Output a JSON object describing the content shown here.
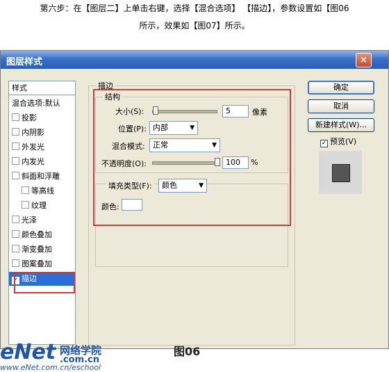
{
  "instruction": {
    "line1": "第六步：在【图层二】上单击右键，选择【混合选项】  【描边】，参数设置如【图06",
    "line2": "所示，效果如【图07】所示。"
  },
  "dialog": {
    "title": "图层样式",
    "close_glyph": "×",
    "left_panel": {
      "header": "样式",
      "items": [
        {
          "label": "混合选项:默认",
          "checkbox": false
        },
        {
          "label": "投影",
          "checkbox": true
        },
        {
          "label": "内阴影",
          "checkbox": true
        },
        {
          "label": "外发光",
          "checkbox": true
        },
        {
          "label": "内发光",
          "checkbox": true
        },
        {
          "label": "斜面和浮雕",
          "checkbox": true
        },
        {
          "label": "等高线",
          "checkbox": true
        },
        {
          "label": "纹理",
          "checkbox": true
        },
        {
          "label": "光泽",
          "checkbox": true
        },
        {
          "label": "颜色叠加",
          "checkbox": true
        },
        {
          "label": "渐变叠加",
          "checkbox": true
        },
        {
          "label": "图案叠加",
          "checkbox": true
        },
        {
          "label": "描边",
          "checkbox": true,
          "checked": true,
          "selected": true
        }
      ]
    },
    "stroke": {
      "title": "描边",
      "structure_title": "结构",
      "size_label": "大小(S):",
      "size_value": "5",
      "size_unit": "像素",
      "position_label": "位置(P):",
      "position_value": "内部",
      "blend_label": "混合模式:",
      "blend_value": "正常",
      "opacity_label": "不透明度(O):",
      "opacity_value": "100",
      "opacity_unit": "%",
      "fill_type_label": "填充类型(F):",
      "fill_type_value": "颜色",
      "color_label": "颜色:",
      "color_value": "#ffffff"
    },
    "buttons": {
      "ok": "确定",
      "cancel": "取消",
      "new_style": "新建样式(W)...",
      "preview": "预览(V)"
    },
    "preview_checked": true,
    "preview_color": "#555555"
  },
  "footer": {
    "logo": "eNet",
    "cn": "网络学院",
    "com": ".com.cn",
    "url": "www.eNet.com.cn/eschool",
    "figure": "图06"
  },
  "colors": {
    "accent": "#2a6fd9",
    "highlight": "#d0373f"
  }
}
